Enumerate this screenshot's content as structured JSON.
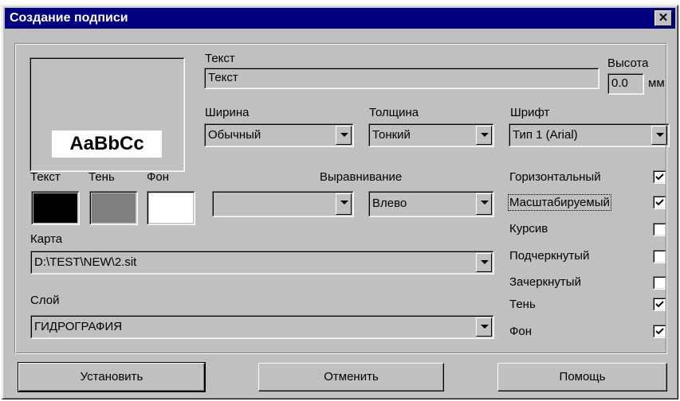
{
  "window": {
    "title": "Создание подписи",
    "close_glyph": "✕"
  },
  "preview": {
    "sample_text": "AaBbCc"
  },
  "colors": {
    "labels": {
      "text": "Текст",
      "shadow": "Тень",
      "background": "Фон"
    },
    "text_color": "#000000",
    "shadow_color": "#808080",
    "background_color": "#ffffff"
  },
  "text_field": {
    "label": "Текст",
    "value": "Текст"
  },
  "height_field": {
    "label": "Высота",
    "value": "0.0",
    "unit": "мм"
  },
  "width_combo": {
    "label": "Ширина",
    "value": "Обычный"
  },
  "thickness_combo": {
    "label": "Толщина",
    "value": "Тонкий"
  },
  "font_combo": {
    "label": "Шрифт",
    "value": "Тип 1 (Arial)"
  },
  "alignment": {
    "label": "Выравнивание",
    "combo1_value": "",
    "combo2_value": "Влево"
  },
  "map_combo": {
    "label": "Карта",
    "value": "D:\\TEST\\NEW\\2.sit"
  },
  "layer_combo": {
    "label": "Слой",
    "value": "ГИДРОГРАФИЯ"
  },
  "options": [
    {
      "label": "Горизонтальный",
      "checked": true
    },
    {
      "label": "Масштабируемый",
      "checked": true
    },
    {
      "label": "Курсив",
      "checked": false
    },
    {
      "label": "Подчеркнутый",
      "checked": false
    },
    {
      "label": "Зачеркнутый",
      "checked": false
    },
    {
      "label": "Тень",
      "checked": true
    },
    {
      "label": "Фон",
      "checked": true
    }
  ],
  "buttons": {
    "set": "Установить",
    "cancel": "Отменить",
    "help": "Помощь"
  }
}
